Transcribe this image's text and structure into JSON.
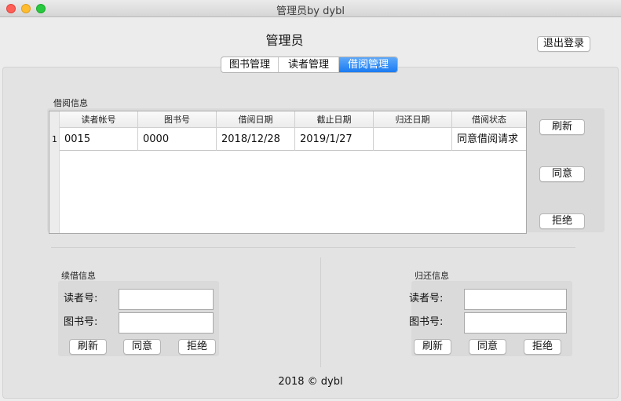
{
  "window": {
    "title": "管理员by dybl"
  },
  "header": {
    "title": "管理员",
    "logout_label": "退出登录"
  },
  "tabs": [
    {
      "label": "图书管理",
      "active": false
    },
    {
      "label": "读者管理",
      "active": false
    },
    {
      "label": "借阅管理",
      "active": true
    }
  ],
  "borrow": {
    "group_label": "借阅信息",
    "columns": [
      "读者帐号",
      "图书号",
      "借阅日期",
      "截止日期",
      "归还日期",
      "借阅状态"
    ],
    "rows": [
      {
        "num": "1",
        "cells": [
          "0015",
          "0000",
          "2018/12/28",
          "2019/1/27",
          "",
          "同意借阅请求"
        ]
      }
    ],
    "buttons": {
      "refresh": "刷新",
      "agree": "同意",
      "reject": "拒绝"
    }
  },
  "renew": {
    "group_label": "续借信息",
    "reader_label": "读者号:",
    "book_label": "图书号:",
    "reader_value": "",
    "book_value": "",
    "buttons": {
      "refresh": "刷新",
      "agree": "同意",
      "reject": "拒绝"
    }
  },
  "return_info": {
    "group_label": "归还信息",
    "reader_label": "读者号:",
    "book_label": "图书号:",
    "reader_value": "",
    "book_value": "",
    "buttons": {
      "refresh": "刷新",
      "agree": "同意",
      "reject": "拒绝"
    }
  },
  "footer": {
    "text": "2018 ©  dybl"
  },
  "colors": {
    "accent": "#1a7bf2",
    "close": "#fe5f57",
    "minimize": "#febc2e",
    "zoom": "#28c840"
  }
}
